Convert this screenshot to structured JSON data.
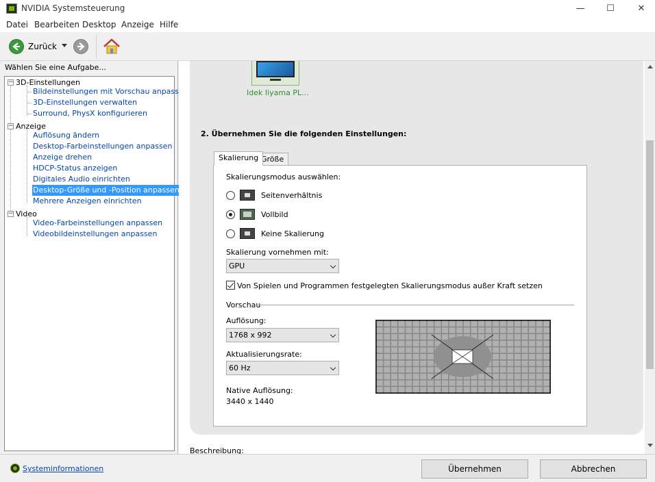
{
  "window": {
    "title": "NVIDIA Systemsteuerung",
    "minimize": "—",
    "maximize": "☐",
    "close": "✕"
  },
  "menu": [
    "Datei",
    "Bearbeiten",
    "Desktop",
    "Anzeige",
    "Hilfe"
  ],
  "toolbar": {
    "back_label": "Zurück"
  },
  "left": {
    "header": "Wählen Sie eine Aufgabe...",
    "categories": [
      {
        "label": "3D-Einstellungen",
        "items": [
          "Bildeinstellungen mit Vorschau anpassen",
          "3D-Einstellungen verwalten",
          "Surround, PhysX konfigurieren"
        ]
      },
      {
        "label": "Anzeige",
        "items": [
          "Auflösung ändern",
          "Desktop-Farbeinstellungen anpassen",
          "Anzeige drehen",
          "HDCP-Status anzeigen",
          "Digitales Audio einrichten",
          "Desktop-Größe und -Position anpassen",
          "Mehrere Anzeigen einrichten"
        ]
      },
      {
        "label": "Video",
        "items": [
          "Video-Farbeinstellungen anpassen",
          "Videobildeinstellungen anpassen"
        ]
      }
    ],
    "selected": "Desktop-Größe und -Position anpassen"
  },
  "main": {
    "monitor_name": "Idek Iiyama PL...",
    "step_title": "2. Übernehmen Sie die folgenden Einstellungen:",
    "tabs": [
      "Skalierung",
      "Größe"
    ],
    "active_tab": "Skalierung",
    "scaling_mode_label": "Skalierungsmodus auswählen:",
    "modes": [
      {
        "label": "Seitenverhältnis",
        "checked": false
      },
      {
        "label": "Vollbild",
        "checked": true
      },
      {
        "label": "Keine Skalierung",
        "checked": false
      }
    ],
    "perform_label": "Skalierung vornehmen mit:",
    "perform_value": "GPU",
    "override_label": "Von Spielen und Programmen festgelegten Skalierungsmodus außer Kraft setzen",
    "override_checked": true,
    "preview_label": "Vorschau",
    "resolution_label": "Auflösung:",
    "resolution_value": "1768 x 992",
    "refresh_label": "Aktualisierungsrate:",
    "refresh_value": "60 Hz",
    "native_label": "Native Auflösung:",
    "native_value": "3440 x 1440",
    "description_label": "Beschreibung:"
  },
  "bottom": {
    "sysinfo": "Systeminformationen",
    "apply": "Übernehmen",
    "cancel": "Abbrechen"
  },
  "colors": {
    "nvidia_green": "#76b900",
    "selection": "#3399ff",
    "link": "#0645ad"
  }
}
